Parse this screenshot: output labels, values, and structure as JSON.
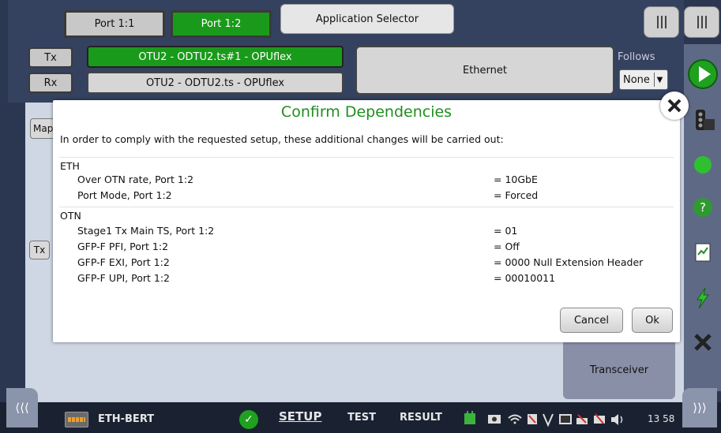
{
  "top": {
    "tabs": [
      {
        "label": "Port 1:1",
        "active": false
      },
      {
        "label": "Port 1:2",
        "active": true
      }
    ],
    "app_selector": "Application Selector",
    "tx_label": "Tx",
    "rx_label": "Rx",
    "tx_path": "OTU2 - ODTU2.ts#1 - OPUflex",
    "rx_path": "OTU2 - ODTU2.ts - OPUflex",
    "payload": "Ethernet",
    "follows_label": "Follows",
    "follows_value": "None"
  },
  "panel": {
    "map_label": "Map",
    "tx_label": "Tx",
    "transceiver_label": "Transceiver"
  },
  "dialog": {
    "title": "Confirm Dependencies",
    "intro": "In order to comply with the requested setup, these additional changes will be carried out:",
    "sections": [
      {
        "header": "ETH",
        "items": [
          {
            "name": "Over OTN rate, Port 1:2",
            "value": "= 10GbE"
          },
          {
            "name": "Port Mode, Port 1:2",
            "value": "= Forced"
          }
        ]
      },
      {
        "header": "OTN",
        "items": [
          {
            "name": "Stage1 Tx Main TS, Port 1:2",
            "value": "= 01"
          },
          {
            "name": "GFP-F PFI, Port 1:2",
            "value": "= Off"
          },
          {
            "name": "GFP-F EXI, Port 1:2",
            "value": "= 0000 Null Extension Header"
          },
          {
            "name": "GFP-F UPI, Port 1:2",
            "value": "= 00010011"
          }
        ]
      }
    ],
    "cancel_label": "Cancel",
    "ok_label": "Ok"
  },
  "bottom": {
    "app_name": "ETH-BERT",
    "modes": [
      "SETUP",
      "TEST",
      "RESULT"
    ],
    "active_mode": "SETUP",
    "clock": "13 58"
  },
  "colors": {
    "accent_green": "#1f8f1f",
    "active_tab": "#1a9a1a",
    "background": "#2b3750"
  }
}
